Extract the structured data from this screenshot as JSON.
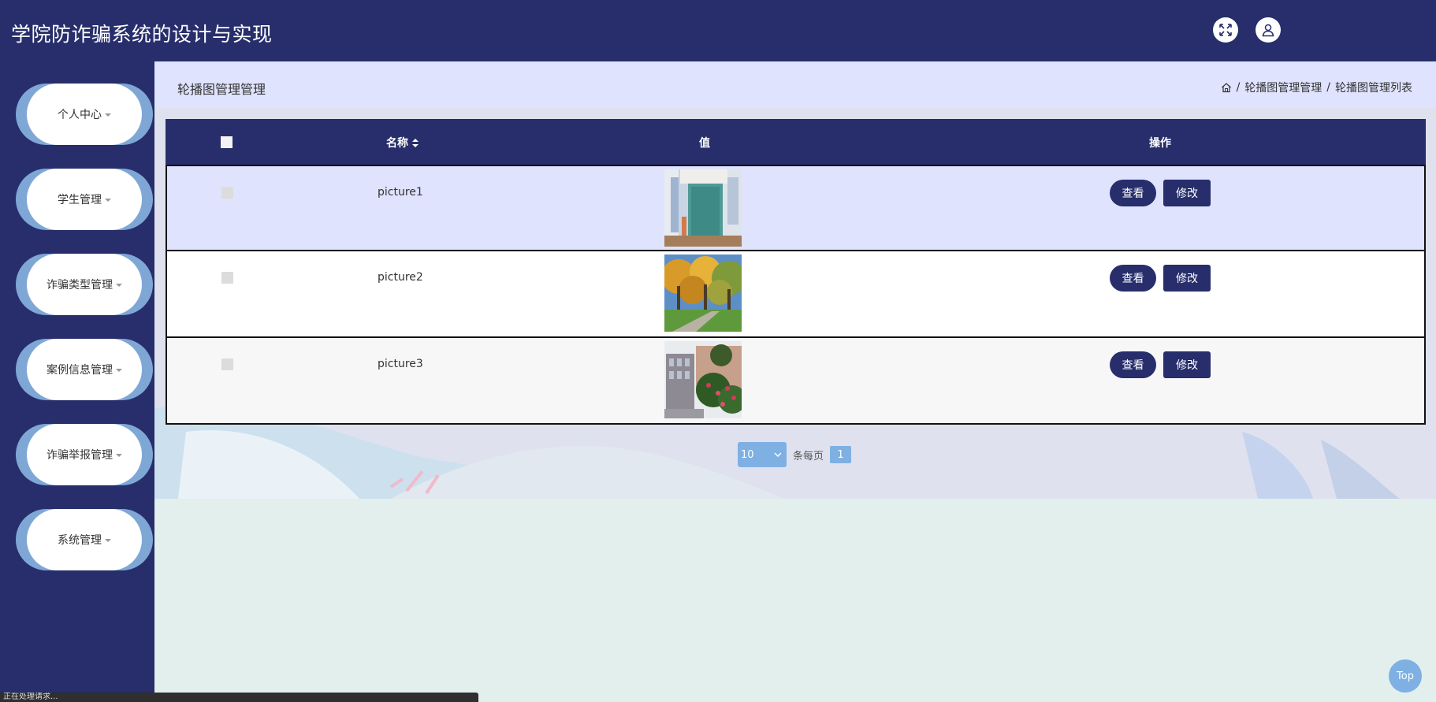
{
  "header": {
    "title": "学院防诈骗系统的设计与实现",
    "fullscreen_icon": "fullscreen-icon",
    "user_icon": "user-icon"
  },
  "sidebar": {
    "items": [
      {
        "label": "个人中心"
      },
      {
        "label": "学生管理"
      },
      {
        "label": "诈骗类型管理"
      },
      {
        "label": "案例信息管理"
      },
      {
        "label": "诈骗举报管理"
      },
      {
        "label": "系统管理"
      }
    ]
  },
  "page": {
    "title": "轮播图管理管理",
    "breadcrumb": [
      "轮播图管理管理",
      "轮播图管理列表"
    ],
    "breadcrumb_sep": "/"
  },
  "table": {
    "headers": {
      "name": "名称",
      "sort_icon": "sort-icon",
      "value": "值",
      "ops": "操作"
    },
    "rows": [
      {
        "name": "picture1",
        "view": "查看",
        "edit": "修改",
        "image": "building-entrance-photo"
      },
      {
        "name": "picture2",
        "view": "查看",
        "edit": "修改",
        "image": "autumn-trees-photo"
      },
      {
        "name": "picture3",
        "view": "查看",
        "edit": "修改",
        "image": "campus-building-flowers-photo"
      }
    ]
  },
  "pagination": {
    "page_size": "10",
    "per_page_label": "条每页",
    "current_page": "1"
  },
  "back_to_top": "Top",
  "status_text": "正在处理请求...",
  "colors": {
    "primary": "#272e6b",
    "accent": "#7fb0e3",
    "highlight_row": "#dfe3fd"
  }
}
